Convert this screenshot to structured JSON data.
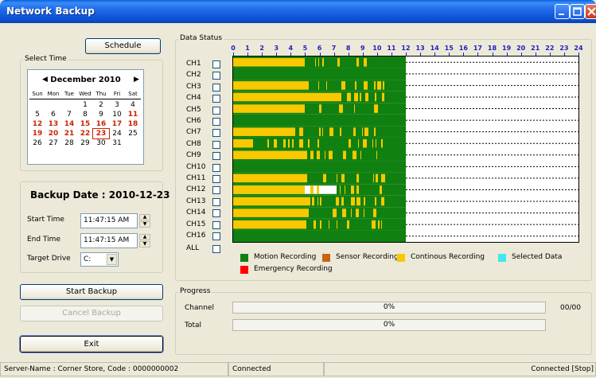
{
  "window": {
    "title": "Network Backup"
  },
  "buttons": {
    "schedule": "Schedule",
    "start_backup": "Start Backup",
    "cancel_backup": "Cancel Backup",
    "exit": "Exit"
  },
  "select_time": {
    "label": "Select Time",
    "month_label": "December 2010",
    "days_of_week": [
      "Sun",
      "Mon",
      "Tue",
      "Wed",
      "Thu",
      "Fri",
      "Sat"
    ],
    "weeks": [
      [
        "",
        "",
        "",
        "1",
        "2",
        "3",
        "4"
      ],
      [
        "5",
        "6",
        "7",
        "8",
        "9",
        "10",
        "11"
      ],
      [
        "12",
        "13",
        "14",
        "15",
        "16",
        "17",
        "18"
      ],
      [
        "19",
        "20",
        "21",
        "22",
        "23",
        "24",
        "25"
      ],
      [
        "26",
        "27",
        "28",
        "29",
        "30",
        "31",
        ""
      ]
    ],
    "highlighted_days": [
      "11",
      "12",
      "13",
      "14",
      "15",
      "16",
      "17",
      "18",
      "19",
      "20",
      "21",
      "22",
      "23"
    ],
    "selected_day": "23"
  },
  "backup": {
    "date_label": "Backup Date : 2010-12-23",
    "start_time_label": "Start Time",
    "start_time": "11:47:15 AM",
    "end_time_label": "End Time",
    "end_time": "11:47:15 AM",
    "target_drive_label": "Target Drive",
    "target_drive": "C:"
  },
  "data_status": {
    "label": "Data Status",
    "hours": [
      "0",
      "1",
      "2",
      "3",
      "4",
      "5",
      "6",
      "7",
      "8",
      "9",
      "10",
      "11",
      "12",
      "13",
      "14",
      "15",
      "16",
      "17",
      "18",
      "19",
      "20",
      "21",
      "22",
      "23",
      "24"
    ],
    "channels": [
      "CH1",
      "CH2",
      "CH3",
      "CH4",
      "CH5",
      "CH6",
      "CH7",
      "CH8",
      "CH9",
      "CH10",
      "CH11",
      "CH12",
      "CH13",
      "CH14",
      "CH15",
      "CH16"
    ],
    "all_label": "ALL",
    "recorded_until_hour": 12,
    "colors": {
      "motion": "#108010",
      "sensor": "#c86414",
      "continuous": "#f8c800",
      "selected": "#40e8f0",
      "emergency": "#ff0000"
    },
    "legend": [
      {
        "key": "motion",
        "label": "Motion Recording"
      },
      {
        "key": "sensor",
        "label": "Sensor Recording"
      },
      {
        "key": "continuous",
        "label": "Continous Recording"
      },
      {
        "key": "selected",
        "label": "Selected Data"
      },
      {
        "key": "emergency",
        "label": "Emergency Recording"
      }
    ]
  },
  "progress": {
    "label": "Progress",
    "channel_label": "Channel",
    "channel_percent": "0%",
    "channel_count": "00/00",
    "total_label": "Total",
    "total_percent": "0%"
  },
  "statusbar": {
    "server": "Server-Name : Corner Store, Code : 0000000002",
    "connection": "Connected",
    "right": "Connected [Stop]"
  }
}
